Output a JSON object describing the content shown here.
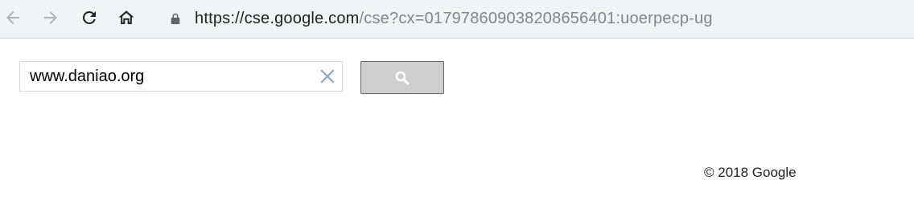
{
  "browser": {
    "url_host": "https://cse.google.com",
    "url_rest": "/cse?cx=017978609038208656401:uoerpecp-ug",
    "icons": {
      "back": "arrow-left-icon",
      "forward": "arrow-right-icon",
      "reload": "reload-icon",
      "home": "home-icon",
      "lock": "lock-icon"
    }
  },
  "search": {
    "query": "www.daniao.org",
    "clear_icon": "close-icon",
    "button_icon": "search-icon",
    "button_color": "#cecece"
  },
  "footer": {
    "copyright": "© 2018 Google"
  }
}
